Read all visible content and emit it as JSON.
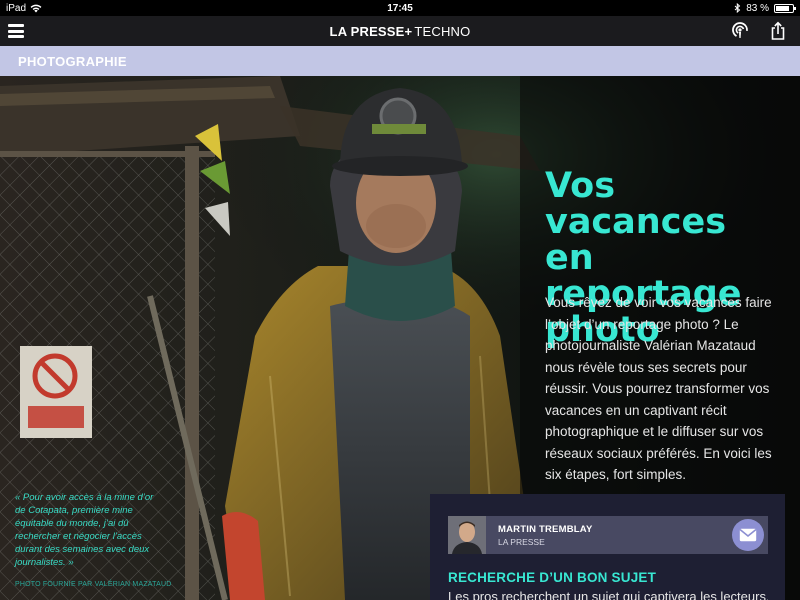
{
  "status_bar": {
    "device": "iPad",
    "time": "17:45",
    "battery": "83 %",
    "battery_level": 0.83
  },
  "app_bar": {
    "brand": "LA PRESSE+",
    "section": "TECHNO"
  },
  "section": {
    "label": "PHOTOGRAPHIE"
  },
  "article": {
    "headline": "Vos vacances en reportage photo",
    "intro": "Vous rêvez de voir vos vacances faire l’objet d’un reportage photo ? Le photojournaliste Valérian Mazataud nous révèle tous ses secrets pour réussir. Vous pourrez transformer vos vacances en un captivant récit photographique et le diffuser sur vos réseaux sociaux préférés. En voici les six étapes, fort simples.",
    "caption": "« Pour avoir accès à la mine d’or de Cotapata, première mine équitable du monde, j’ai dû rechercher et négocier l’accès durant des semaines avec deux journalistes. »",
    "credit": "PHOTO FOURNIE PAR VALÉRIAN MAZATAUD",
    "author_name": "MARTIN TREMBLAY",
    "author_org": "LA PRESSE",
    "subhead": "RECHERCHE D’UN BON SUJET",
    "body_start": "Les pros recherchent un sujet qui captivera les lecteurs."
  },
  "colors": {
    "accent": "#38e7d2",
    "section_band": "#c2c6e5",
    "panel": "#1e1f33",
    "author_card": "#484962",
    "contact_button": "#8c8fd2"
  },
  "icons": {
    "menu": "hamburger-icon",
    "podcast": "podcast-icon",
    "share": "share-icon",
    "contact": "mail-icon",
    "wifi": "wifi-icon",
    "bluetooth": "bluetooth-icon",
    "battery": "battery-icon"
  }
}
